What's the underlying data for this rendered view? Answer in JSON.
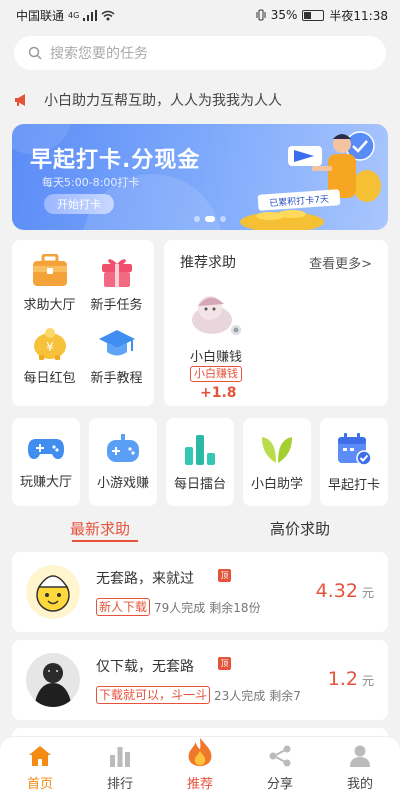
{
  "status_bar": {
    "carrier": "中国联通",
    "network": "4G",
    "battery": "35%",
    "time": "半夜11:38"
  },
  "search": {
    "placeholder": "搜索您要的任务"
  },
  "notice": {
    "text": "小白助力互帮互助，人人为我我为人人"
  },
  "banner": {
    "title": "早起打卡.分现金",
    "subtitle": "每天5:00-8:00打卡",
    "button": "开始打卡",
    "tag": "已累积打卡7天"
  },
  "quick_menu": [
    {
      "label": "求助大厅",
      "icon": "briefcase-icon"
    },
    {
      "label": "新手任务",
      "icon": "gift-icon"
    },
    {
      "label": "每日红包",
      "icon": "piggy-bank-icon"
    },
    {
      "label": "新手教程",
      "icon": "graduation-cap-icon"
    }
  ],
  "recommend": {
    "title": "推荐求助",
    "more": "查看更多>",
    "name": "小白赚钱",
    "badge": "小白赚钱",
    "amount": "+1.8"
  },
  "tiles": [
    {
      "label": "玩赚大厅",
      "icon": "gamepad-icon"
    },
    {
      "label": "小游戏赚",
      "icon": "controller-icon"
    },
    {
      "label": "每日擂台",
      "icon": "bar-chart-icon"
    },
    {
      "label": "小白助学",
      "icon": "sprout-icon"
    },
    {
      "label": "早起打卡",
      "icon": "calendar-check-icon"
    }
  ],
  "tabs": [
    {
      "label": "最新求助",
      "active": true
    },
    {
      "label": "高价求助",
      "active": false
    }
  ],
  "tasks": [
    {
      "title": "无套路，来就过",
      "top": "顶",
      "label": "新人下载",
      "done": "79人完成",
      "remain": "剩余18份",
      "price": "4.32",
      "unit": "元"
    },
    {
      "title": "仅下载，无套路",
      "top": "顶",
      "label": "下载就可以，斗一斗",
      "done": "23人完成",
      "remain": "剩余7",
      "price": "1.2",
      "unit": "元"
    }
  ],
  "bottom_nav": [
    {
      "label": "首页",
      "icon": "home-icon",
      "active": true
    },
    {
      "label": "排行",
      "icon": "ranking-icon",
      "active": false
    },
    {
      "label": "推荐",
      "icon": "flame-icon",
      "active": false
    },
    {
      "label": "分享",
      "icon": "share-icon",
      "active": false
    },
    {
      "label": "我的",
      "icon": "user-icon",
      "active": false
    }
  ],
  "colors": {
    "accent": "#e5533b",
    "active_nav": "#f28a14",
    "banner": "#5b8cf7"
  }
}
